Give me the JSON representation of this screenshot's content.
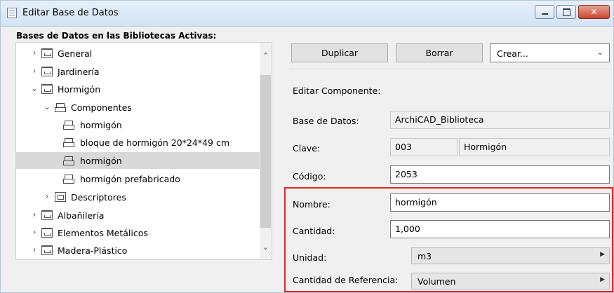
{
  "window": {
    "title": "Editar Base de Datos"
  },
  "tree": {
    "header": "Bases de Datos en las Bibliotecas Activas:",
    "items": [
      {
        "label": "General",
        "kind": "folder",
        "expander": "›"
      },
      {
        "label": "Jardinería",
        "kind": "folder",
        "expander": "›"
      },
      {
        "label": "Hormigón",
        "kind": "folder",
        "expander": "⌄"
      },
      {
        "label": "Componentes",
        "kind": "components",
        "expander": "⌄"
      },
      {
        "label": "hormigón",
        "kind": "component",
        "expander": ""
      },
      {
        "label": "bloque de hormigón 20*24*49 cm",
        "kind": "component",
        "expander": ""
      },
      {
        "label": "hormigón",
        "kind": "component",
        "expander": "",
        "selected": true
      },
      {
        "label": "hormigón prefabricado",
        "kind": "component",
        "expander": ""
      },
      {
        "label": "Descriptores",
        "kind": "descriptors",
        "expander": "›"
      },
      {
        "label": "Albañilería",
        "kind": "folder",
        "expander": "›"
      },
      {
        "label": "Elementos Metálicos",
        "kind": "folder",
        "expander": "›"
      },
      {
        "label": "Madera-Plástico",
        "kind": "folder",
        "expander": "›"
      }
    ]
  },
  "toolbar": {
    "duplicate_label": "Duplicar",
    "delete_label": "Borrar",
    "create_value": "Crear..."
  },
  "editor": {
    "section_label": "Editar Componente:",
    "database_label": "Base de Datos:",
    "database_value": "ArchiCAD_Biblioteca",
    "key_label": "Clave:",
    "key_code": "003",
    "key_name": "Hormigón",
    "code_label": "Código:",
    "code_value": "2053",
    "name_label": "Nombre:",
    "name_value": "hormigón",
    "quantity_label": "Cantidad:",
    "quantity_value": "1,000",
    "unit_label": "Unidad:",
    "unit_value": "m3",
    "refqty_label": "Cantidad de Referencia:",
    "refqty_value": "Volumen"
  },
  "colors": {
    "highlight": "#e0272b",
    "selection": "#d9d9d9",
    "close_button": "#c9452f"
  }
}
